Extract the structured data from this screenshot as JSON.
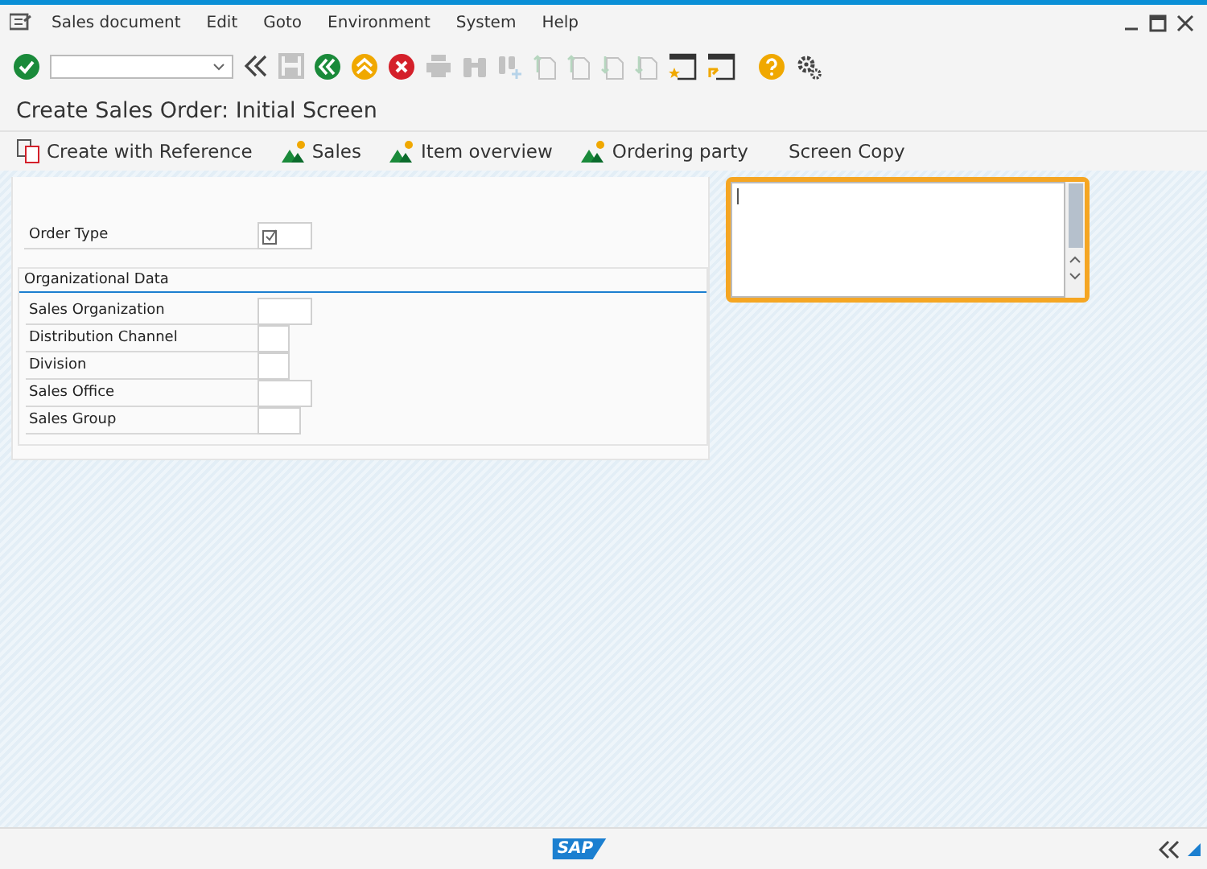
{
  "menu_bar": {
    "items": [
      "Sales document",
      "Edit",
      "Goto",
      "Environment",
      "System",
      "Help"
    ]
  },
  "toolbar": {
    "buttons": [
      {
        "kind": "enter",
        "disabled": false
      },
      {
        "kind": "command",
        "disabled": false
      },
      {
        "kind": "collapse",
        "disabled": false
      },
      {
        "kind": "save",
        "disabled": true
      },
      {
        "kind": "back",
        "disabled": false
      },
      {
        "kind": "exit",
        "disabled": false
      },
      {
        "kind": "cancel",
        "disabled": false
      },
      {
        "kind": "print",
        "disabled": true
      },
      {
        "kind": "find",
        "disabled": true
      },
      {
        "kind": "find-next",
        "disabled": true
      },
      {
        "kind": "first-page",
        "disabled": true
      },
      {
        "kind": "previous-page",
        "disabled": true
      },
      {
        "kind": "next-page",
        "disabled": true
      },
      {
        "kind": "last-page",
        "disabled": true
      },
      {
        "kind": "new-session",
        "disabled": false
      },
      {
        "kind": "shortcut",
        "disabled": false
      },
      {
        "kind": "help",
        "disabled": false
      },
      {
        "kind": "settings",
        "disabled": false
      }
    ]
  },
  "screen_title": "Create Sales Order: Initial Screen",
  "app_toolbar": [
    {
      "label": "Create with Reference",
      "kind": "reference"
    },
    {
      "label": "Sales",
      "kind": "overview"
    },
    {
      "label": "Item overview",
      "kind": "overview"
    },
    {
      "label": "Ordering party",
      "kind": "overview"
    },
    {
      "label": "Screen Copy",
      "kind": "plain"
    }
  ],
  "order_type": {
    "label": "Order Type"
  },
  "organizational_data": {
    "title": "Organizational Data",
    "fields": [
      {
        "label": "Sales Organization",
        "kind": "wide"
      },
      {
        "label": "Distribution Channel",
        "kind": "narrow"
      },
      {
        "label": "Division",
        "kind": "narrow"
      },
      {
        "label": "Sales Office",
        "kind": "wide"
      },
      {
        "label": "Sales Group",
        "kind": "medium"
      }
    ]
  },
  "text_editor": {
    "focused": true
  },
  "status_bar": {
    "logo": "SAP"
  }
}
